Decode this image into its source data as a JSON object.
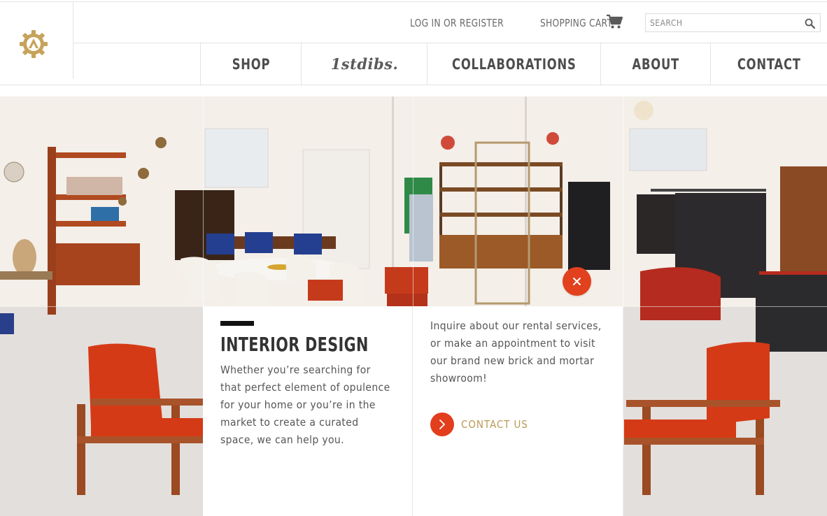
{
  "header": {
    "login_label": "LOG IN OR REGISTER",
    "cart_label": "SHOPPING CART",
    "search_placeholder": "SEARCH",
    "search_value": ""
  },
  "nav": {
    "items": [
      {
        "label": "SHOP"
      },
      {
        "label": "1stdibs."
      },
      {
        "label": "COLLABORATIONS"
      },
      {
        "label": "ABOUT"
      },
      {
        "label": "CONTACT"
      }
    ]
  },
  "info_panel": {
    "title": "INTERIOR DESIGN",
    "description": "Whether you’re searching for that perfect element of opulence for your home or you’re in the market to create a curated space, we can help you.",
    "inquiry_text": "Inquire about our rental services, or make an appointment to visit our brand new brick and mortar showroom!",
    "contact_label": "CONTACT US"
  },
  "icons": {
    "logo": "gear-logo-icon",
    "cart": "shopping-cart-icon",
    "search": "search-icon",
    "close": "close-icon",
    "contact_arrow": "chevron-right-icon"
  },
  "colors": {
    "accent_red": "#e2411d",
    "gold": "#b99a55",
    "nav_text": "#4d4d4d"
  }
}
